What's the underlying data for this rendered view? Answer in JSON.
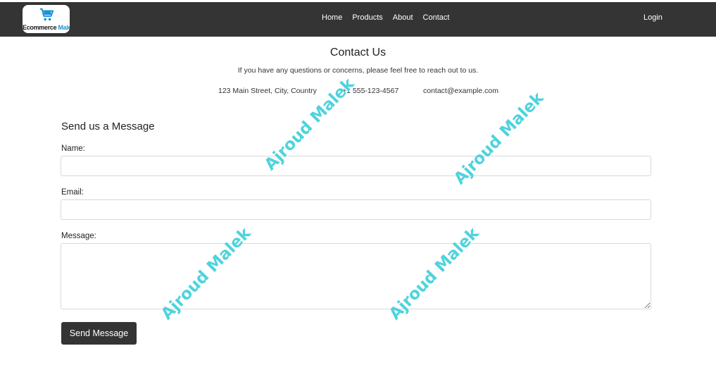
{
  "brand": {
    "logo_word1": "Ecommerce",
    "logo_word2": "Malek",
    "icon": "shopping-cart-icon"
  },
  "nav": {
    "links": [
      "Home",
      "Products",
      "About",
      "Contact"
    ],
    "login": "Login"
  },
  "header": {
    "title": "Contact Us",
    "subtitle": "If you have any questions or concerns, please feel free to reach out to us."
  },
  "contact_info": {
    "address": "123 Main Street, City, Country",
    "phone": "+1 555-123-4567",
    "email": "contact@example.com"
  },
  "form": {
    "title": "Send us a Message",
    "name_label": "Name:",
    "name_value": "",
    "email_label": "Email:",
    "email_value": "",
    "message_label": "Message:",
    "message_value": "",
    "submit_label": "Send Message"
  },
  "watermark": "Ajroud Malek",
  "colors": {
    "navbar": "#343434",
    "button": "#343434",
    "watermark": "#4fd3dd",
    "brand_accent": "#1e90d6"
  }
}
